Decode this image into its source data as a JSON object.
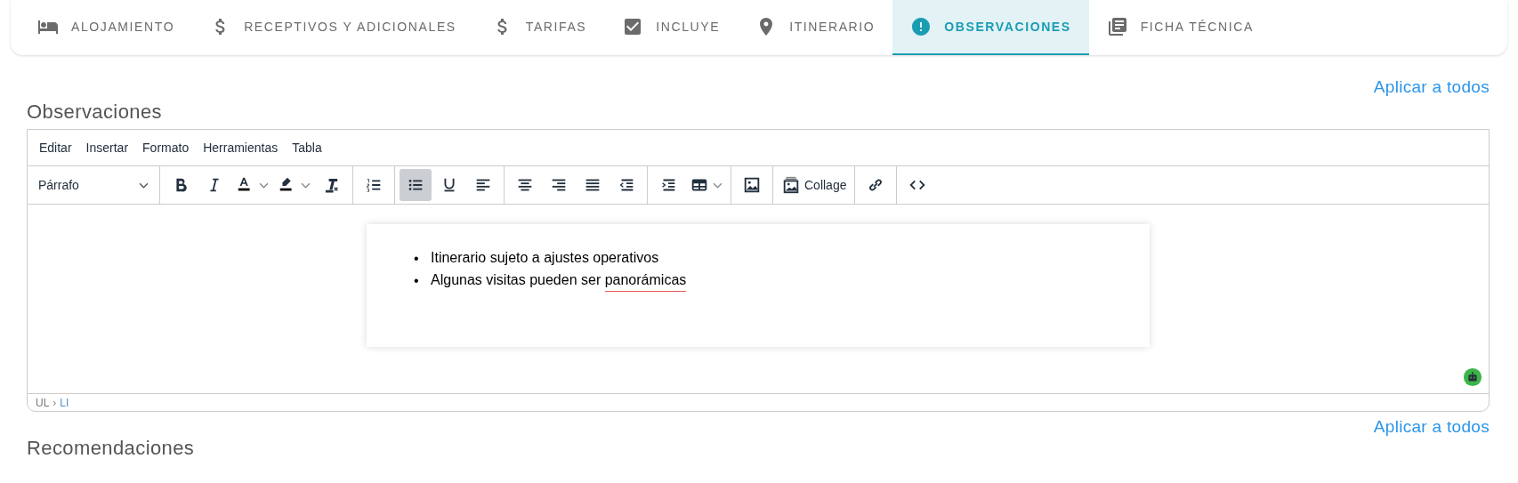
{
  "tabs": [
    {
      "label": "ALOJAMIENTO",
      "selected": false
    },
    {
      "label": "RECEPTIVOS Y ADICIONALES",
      "selected": false
    },
    {
      "label": "TARIFAS",
      "selected": false
    },
    {
      "label": "INCLUYE",
      "selected": false
    },
    {
      "label": "ITINERARIO",
      "selected": false
    },
    {
      "label": "OBSERVACIONES",
      "selected": true
    },
    {
      "label": "FICHA TÉCNICA",
      "selected": false
    }
  ],
  "apply_link_top": "Aplicar a todos",
  "section_title": "Observaciones",
  "editor": {
    "menu": [
      "Editar",
      "Insertar",
      "Formato",
      "Herramientas",
      "Tabla"
    ],
    "format": "Párrafo",
    "buttons": [
      {
        "selected": false
      },
      {
        "selected": false
      },
      {
        "selected": false
      },
      {
        "selected": false
      },
      {
        "selected": false
      },
      {
        "selected": false
      },
      {
        "selected": true
      },
      {
        "selected": false
      },
      {
        "selected": false
      },
      {
        "selected": false
      },
      {
        "selected": false
      },
      {
        "selected": false
      },
      {
        "selected": false
      },
      {
        "selected": false
      },
      {
        "selected": false
      },
      {
        "selected": false
      },
      {
        "label": "Collage",
        "selected": false
      },
      {
        "selected": false
      },
      {
        "selected": false
      }
    ],
    "content": [
      {
        "parts": [
          {
            "text": "Itinerario sujeto a ajustes operativos",
            "misspelled": false
          }
        ]
      },
      {
        "parts": [
          {
            "text": "Algunas visitas pueden ser ",
            "misspelled": false
          },
          {
            "text": "panorámicas",
            "misspelled": true
          }
        ]
      }
    ],
    "bullet": "•",
    "path": [
      "UL",
      "LI"
    ],
    "path_separator": "›"
  },
  "apply_link_bottom": "Aplicar a todos",
  "next_section_title": "Recomendaciones"
}
